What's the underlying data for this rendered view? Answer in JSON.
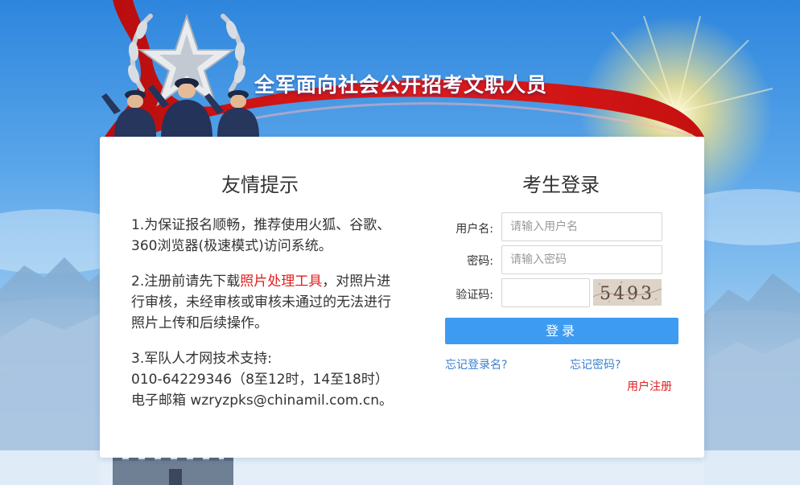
{
  "banner": {
    "title": "全军面向社会公开招考文职人员"
  },
  "tips": {
    "title": "友情提示",
    "item1": "1.为保证报名顺畅，推荐使用火狐、谷歌、360浏览器(极速模式)访问系统。",
    "item2_prefix": "2.注册前请先下载",
    "item2_link": "照片处理工具",
    "item2_suffix": "，对照片进行审核，未经审核或审核未通过的无法进行照片上传和后续操作。",
    "item3_line1": "3.军队人才网技术支持:",
    "item3_line2": "010-64229346（8至12时，14至18时）",
    "item3_line3": "电子邮箱 wzryzpks@chinamil.com.cn。"
  },
  "login": {
    "title": "考生登录",
    "username_label": "用户名:",
    "username_placeholder": "请输入用户名",
    "password_label": "密码:",
    "password_placeholder": "请输入密码",
    "captcha_label": "验证码:",
    "captcha_value": "",
    "captcha_text": "5493",
    "submit_label": "登录",
    "forgot_username": "忘记登录名?",
    "forgot_password": "忘记密码?",
    "register": "用户注册"
  },
  "colors": {
    "accent_blue": "#3e9bf2",
    "link_blue": "#3a7fd0",
    "highlight_red": "#e31d1d"
  }
}
